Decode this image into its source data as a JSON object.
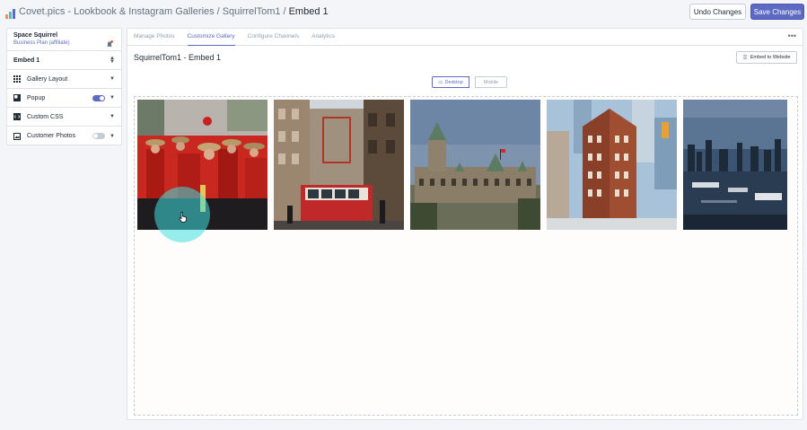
{
  "header": {
    "crumbs": [
      "Covet.pics - Lookbook & Instagram Galleries",
      "SquirrelTom1",
      "Embed 1"
    ],
    "separator": "/",
    "undo_label": "Undo Changes",
    "save_label": "Save Changes"
  },
  "sidebar": {
    "account_name": "Space Squirrel",
    "account_plan": "Business Plan (affiliate)",
    "embed_select": "Embed 1",
    "items": [
      {
        "label": "Gallery Layout",
        "icon": "grid-icon"
      },
      {
        "label": "Popup",
        "icon": "popup-icon",
        "toggle": "on"
      },
      {
        "label": "Custom CSS",
        "icon": "code-icon"
      },
      {
        "label": "Customer Photos",
        "icon": "photos-icon",
        "toggle": "off"
      }
    ]
  },
  "main": {
    "tabs": [
      {
        "label": "Manage Photos",
        "active": false
      },
      {
        "label": "Customize Gallery",
        "active": true
      },
      {
        "label": "Configure Channels",
        "active": false
      },
      {
        "label": "Analytics",
        "active": false
      }
    ],
    "more_label": "•••",
    "title": "SquirrelTom1 - Embed 1",
    "embed_button_label": "Embed to Website",
    "view_desktop_label": "Desktop",
    "view_mobile_label": "Mobile"
  },
  "gallery": {
    "photos": [
      {
        "subject": "mounties-parade"
      },
      {
        "subject": "streetcar-street"
      },
      {
        "subject": "parliament-building"
      },
      {
        "subject": "flatiron-building"
      },
      {
        "subject": "harbour-skyline"
      }
    ]
  },
  "colors": {
    "accent": "#5c6ac4",
    "click_halo": "#40e0e0"
  }
}
